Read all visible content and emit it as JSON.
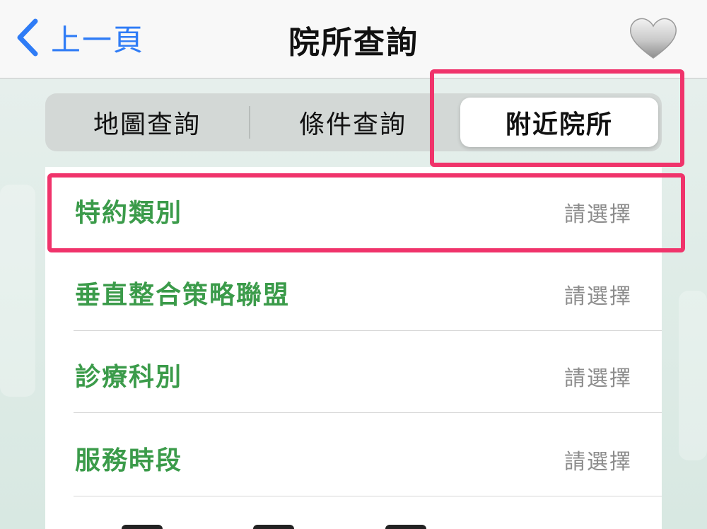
{
  "nav": {
    "back_label": "上一頁",
    "title": "院所查詢",
    "favorite_icon": "heart-icon"
  },
  "segments": [
    {
      "label": "地圖查詢",
      "selected": false
    },
    {
      "label": "條件查詢",
      "selected": false
    },
    {
      "label": "附近院所",
      "selected": true
    }
  ],
  "filters": [
    {
      "label": "特約類別",
      "value": "請選擇"
    },
    {
      "label": "垂直整合策略聯盟",
      "value": "請選擇"
    },
    {
      "label": "診療科別",
      "value": "請選擇"
    },
    {
      "label": "服務時段",
      "value": "請選擇"
    }
  ],
  "colors": {
    "accent_blue": "#2f7cf6",
    "label_green": "#3b9b4a",
    "highlight_pink": "#f0336b"
  }
}
